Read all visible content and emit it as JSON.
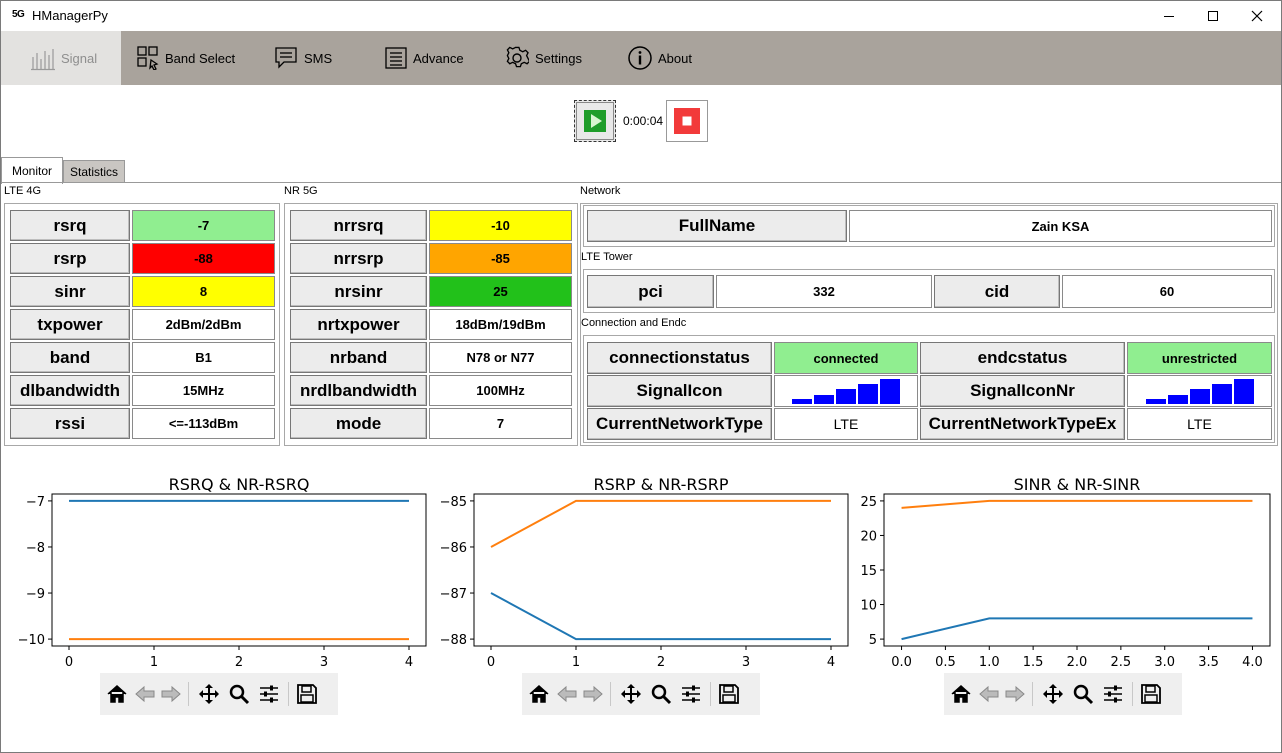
{
  "window": {
    "app_icon_text": "5G",
    "title": "HManagerPy"
  },
  "toolbar": {
    "signal": "Signal",
    "band_select": "Band Select",
    "sms": "SMS",
    "advance": "Advance",
    "settings": "Settings",
    "about": "About"
  },
  "controls": {
    "elapsed": "0:00:04"
  },
  "tabs": {
    "monitor": "Monitor",
    "statistics": "Statistics"
  },
  "lte": {
    "title": "LTE 4G",
    "rows": [
      {
        "label": "rsrq",
        "value": "-7",
        "color": "#90ee90"
      },
      {
        "label": "rsrp",
        "value": "-88",
        "color": "#ff0000"
      },
      {
        "label": "sinr",
        "value": "8",
        "color": "#ffff00"
      },
      {
        "label": "txpower",
        "value": "2dBm/2dBm",
        "color": "#ffffff"
      },
      {
        "label": "band",
        "value": "B1",
        "color": "#ffffff"
      },
      {
        "label": "dlbandwidth",
        "value": "15MHz",
        "color": "#ffffff"
      },
      {
        "label": "rssi",
        "value": "<=-113dBm",
        "color": "#ffffff"
      }
    ]
  },
  "nr": {
    "title": "NR 5G",
    "rows": [
      {
        "label": "nrrsrq",
        "value": "-10",
        "color": "#ffff00"
      },
      {
        "label": "nrrsrp",
        "value": "-85",
        "color": "#ffa500"
      },
      {
        "label": "nrsinr",
        "value": "25",
        "color": "#22c11a"
      },
      {
        "label": "nrtxpower",
        "value": "18dBm/19dBm",
        "color": "#ffffff"
      },
      {
        "label": "nrband",
        "value": "N78 or N77",
        "color": "#ffffff"
      },
      {
        "label": "nrdlbandwidth",
        "value": "100MHz",
        "color": "#ffffff"
      },
      {
        "label": "mode",
        "value": "7",
        "color": "#ffffff"
      }
    ]
  },
  "network": {
    "title": "Network",
    "fullname_label": "FullName",
    "fullname_value": "Zain KSA",
    "tower_title": "LTE Tower",
    "pci_label": "pci",
    "pci_value": "332",
    "cid_label": "cid",
    "cid_value": "60",
    "conn_title": "Connection and Endc",
    "connectionstatus_label": "connectionstatus",
    "connectionstatus_value": "connected",
    "connectionstatus_color": "#90ee90",
    "endcstatus_label": "endcstatus",
    "endcstatus_value": "unrestricted",
    "endcstatus_color": "#90ee90",
    "signalicon_label": "SignalIcon",
    "signalicon_level": 5,
    "signaliconnr_label": "SignalIconNr",
    "signaliconnr_level": 5,
    "signal_bar_color": "#0000ff",
    "currentnetworktype_label": "CurrentNetworkType",
    "currentnetworktype_value": "LTE",
    "currentnetworktypeex_label": "CurrentNetworkTypeEx",
    "currentnetworktypeex_value": "LTE"
  },
  "chart_data": [
    {
      "type": "line",
      "title": "RSRQ & NR-RSRQ",
      "x": [
        0,
        1,
        2,
        3,
        4
      ],
      "series": [
        {
          "values": [
            -7,
            -7,
            -7,
            -7,
            -7
          ],
          "color": "#1f77b4"
        },
        {
          "values": [
            -10,
            -10,
            -10,
            -10,
            -10
          ],
          "color": "#ff7f0e"
        }
      ],
      "xlim": [
        -0.2,
        4.2
      ],
      "ylim": [
        -10.15,
        -6.85
      ],
      "xticks": [
        0,
        1,
        2,
        3,
        4
      ],
      "yticks": [
        -10,
        -9,
        -8,
        -7
      ],
      "xlabel": "",
      "ylabel": ""
    },
    {
      "type": "line",
      "title": "RSRP & NR-RSRP",
      "x": [
        0,
        1,
        2,
        3,
        4
      ],
      "series": [
        {
          "values": [
            -87,
            -88,
            -88,
            -88,
            -88
          ],
          "color": "#1f77b4"
        },
        {
          "values": [
            -86,
            -85,
            -85,
            -85,
            -85
          ],
          "color": "#ff7f0e"
        }
      ],
      "xlim": [
        -0.2,
        4.2
      ],
      "ylim": [
        -88.15,
        -84.85
      ],
      "xticks": [
        0,
        1,
        2,
        3,
        4
      ],
      "yticks": [
        -88,
        -87,
        -86,
        -85
      ],
      "xlabel": "",
      "ylabel": ""
    },
    {
      "type": "line",
      "title": "SINR & NR-SINR",
      "x": [
        0,
        1,
        2,
        3,
        4
      ],
      "series": [
        {
          "values": [
            5,
            8,
            8,
            8,
            8
          ],
          "color": "#1f77b4"
        },
        {
          "values": [
            24,
            25,
            25,
            25,
            25
          ],
          "color": "#ff7f0e"
        }
      ],
      "xlim": [
        -0.2,
        4.2
      ],
      "ylim": [
        4,
        26
      ],
      "xticks": [
        0,
        0.5,
        1,
        1.5,
        2,
        2.5,
        3,
        3.5,
        4
      ],
      "xticklabels": [
        "0.0",
        "0.5",
        "1.0",
        "1.5",
        "2.0",
        "2.5",
        "3.0",
        "3.5",
        "4.0"
      ],
      "yticks": [
        5,
        10,
        15,
        20,
        25
      ],
      "xlabel": "",
      "ylabel": ""
    }
  ]
}
